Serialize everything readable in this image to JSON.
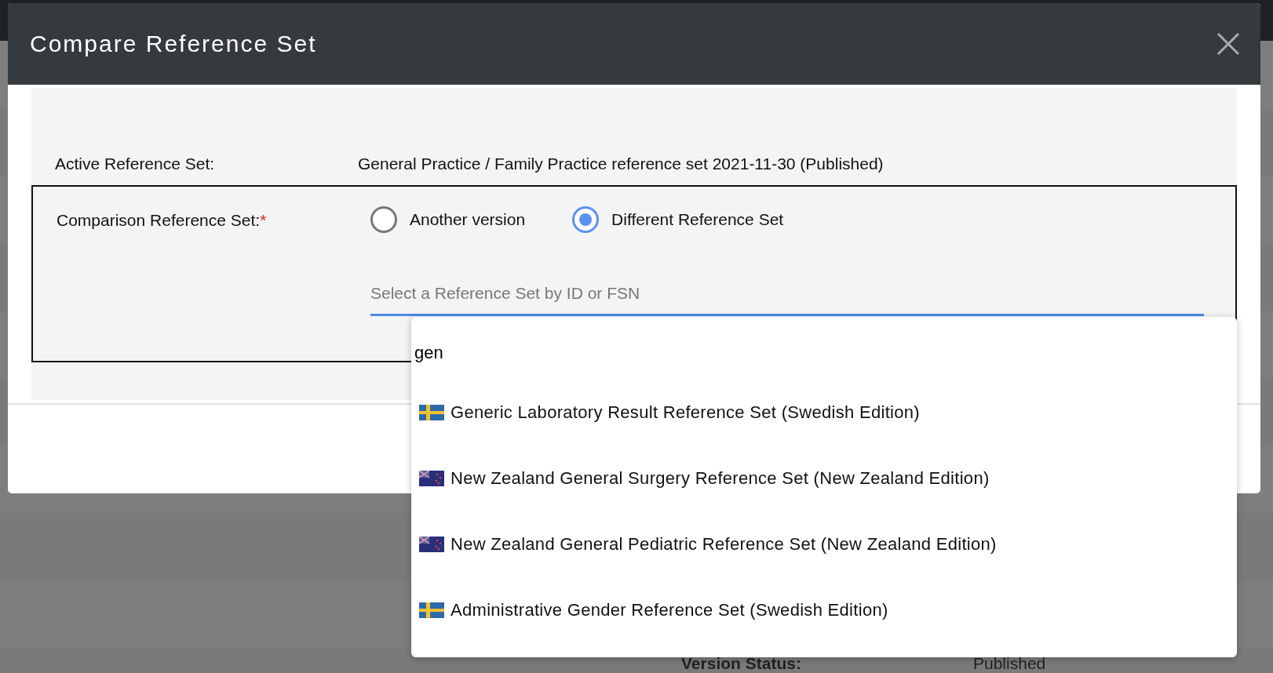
{
  "page": {
    "version_status_label": "Version Status:",
    "version_status_value": "Published"
  },
  "dialog": {
    "title": "Compare Reference Set",
    "active_label": "Active Reference Set:",
    "active_value": "General Practice / Family Practice reference set 2021-11-30 (Published)",
    "comparison_label": "Comparison Reference Set:",
    "required_mark": "*",
    "options": [
      {
        "label": "Another version",
        "selected": false
      },
      {
        "label": "Different Reference Set",
        "selected": true
      }
    ],
    "select": {
      "placeholder": "Select a Reference Set by ID or FSN"
    }
  },
  "dropdown": {
    "search_value": "gen",
    "results": [
      {
        "kind": "se",
        "label": "Generic Laboratory Result Reference Set (Swedish Edition)"
      },
      {
        "kind": "nz",
        "label": "New Zealand General Surgery Reference Set (New Zealand Edition)"
      },
      {
        "kind": "nz",
        "label": "New Zealand General Pediatric Reference Set (New Zealand Edition)"
      },
      {
        "kind": "se",
        "label": "Administrative Gender Reference Set (Swedish Edition)"
      }
    ]
  }
}
